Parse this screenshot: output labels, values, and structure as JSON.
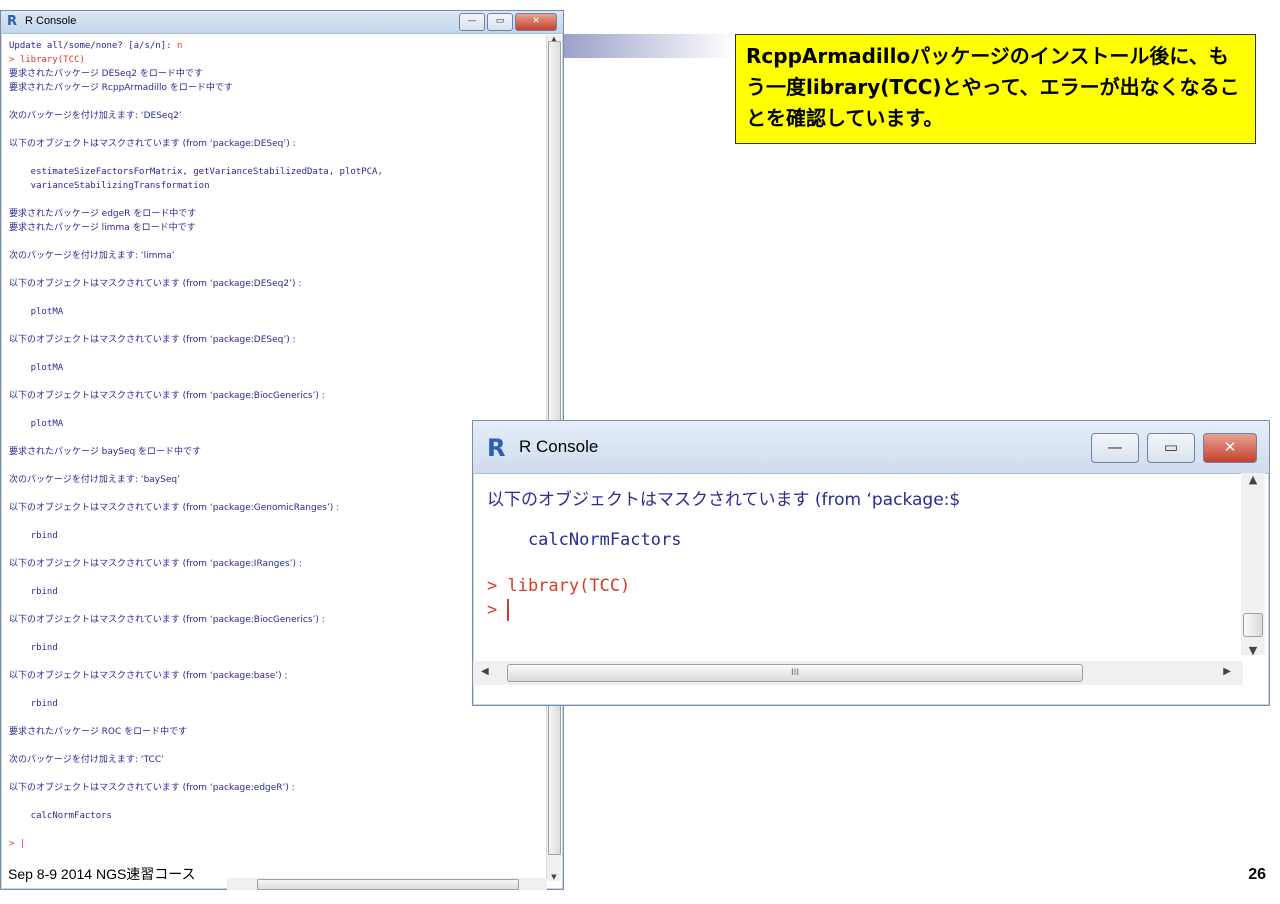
{
  "console_window": {
    "title": "R Console",
    "lines": [
      {
        "text": "Update all/some/none? [a/s/n]: ",
        "red_suffix": "n"
      },
      {
        "text": "> library(TCC)",
        "red": true
      },
      {
        "text": "要求されたパッケージ DESeq2 をロード中です",
        "jp": true
      },
      {
        "text": "要求されたパッケージ RcppArmadillo をロード中です",
        "jp": true
      },
      {
        "text": ""
      },
      {
        "text": "次のパッケージを付け加えます: ‘DESeq2’",
        "jp": true
      },
      {
        "text": ""
      },
      {
        "text": "以下のオブジェクトはマスクされています (from ‘package:DESeq’) :",
        "jp": true
      },
      {
        "text": ""
      },
      {
        "text": "    estimateSizeFactorsForMatrix, getVarianceStabilizedData, plotPCA,"
      },
      {
        "text": "    varianceStabilizingTransformation"
      },
      {
        "text": ""
      },
      {
        "text": "要求されたパッケージ edgeR をロード中です",
        "jp": true
      },
      {
        "text": "要求されたパッケージ limma をロード中です",
        "jp": true
      },
      {
        "text": ""
      },
      {
        "text": "次のパッケージを付け加えます: ‘limma’",
        "jp": true
      },
      {
        "text": ""
      },
      {
        "text": "以下のオブジェクトはマスクされています (from ‘package:DESeq2’) :",
        "jp": true
      },
      {
        "text": ""
      },
      {
        "text": "    plotMA"
      },
      {
        "text": ""
      },
      {
        "text": "以下のオブジェクトはマスクされています (from ‘package:DESeq’) :",
        "jp": true
      },
      {
        "text": ""
      },
      {
        "text": "    plotMA"
      },
      {
        "text": ""
      },
      {
        "text": "以下のオブジェクトはマスクされています (from ‘package:BiocGenerics’) :",
        "jp": true
      },
      {
        "text": ""
      },
      {
        "text": "    plotMA"
      },
      {
        "text": ""
      },
      {
        "text": "要求されたパッケージ baySeq をロード中です",
        "jp": true
      },
      {
        "text": ""
      },
      {
        "text": "次のパッケージを付け加えます: ‘baySeq’",
        "jp": true
      },
      {
        "text": ""
      },
      {
        "text": "以下のオブジェクトはマスクされています (from ‘package:GenomicRanges’) :",
        "jp": true
      },
      {
        "text": ""
      },
      {
        "text": "    rbind"
      },
      {
        "text": ""
      },
      {
        "text": "以下のオブジェクトはマスクされています (from ‘package:IRanges’) :",
        "jp": true
      },
      {
        "text": ""
      },
      {
        "text": "    rbind"
      },
      {
        "text": ""
      },
      {
        "text": "以下のオブジェクトはマスクされています (from ‘package:BiocGenerics’) :",
        "jp": true
      },
      {
        "text": ""
      },
      {
        "text": "    rbind"
      },
      {
        "text": ""
      },
      {
        "text": "以下のオブジェクトはマスクされています (from ‘package:base’) :",
        "jp": true
      },
      {
        "text": ""
      },
      {
        "text": "    rbind"
      },
      {
        "text": ""
      },
      {
        "text": "要求されたパッケージ ROC をロード中です",
        "jp": true
      },
      {
        "text": ""
      },
      {
        "text": "次のパッケージを付け加えます: ‘TCC’",
        "jp": true
      },
      {
        "text": ""
      },
      {
        "text": "以下のオブジェクトはマスクされています (from ‘package:edgeR’) :",
        "jp": true
      },
      {
        "text": ""
      },
      {
        "text": "    calcNormFactors"
      },
      {
        "text": ""
      },
      {
        "text": "> |",
        "red": true
      }
    ]
  },
  "callout": {
    "text": "RcppArmadilloパッケージのインストール後に、もう一度library(TCC)とやって、エラーが出なくなることを確認しています。"
  },
  "zoom_window": {
    "title": "R Console",
    "line1": "以下のオブジェクトはマスクされています (from ‘package:$",
    "line2": "    calcNormFactors",
    "line3": "> library(TCC)",
    "line4_prompt": "> ",
    "hscroll_grip": "III"
  },
  "footer": "Sep 8-9 2014 NGS速習コース",
  "page_number": "26",
  "window_buttons": {
    "minimize": "—",
    "maximize": "▭",
    "close": "✕"
  }
}
